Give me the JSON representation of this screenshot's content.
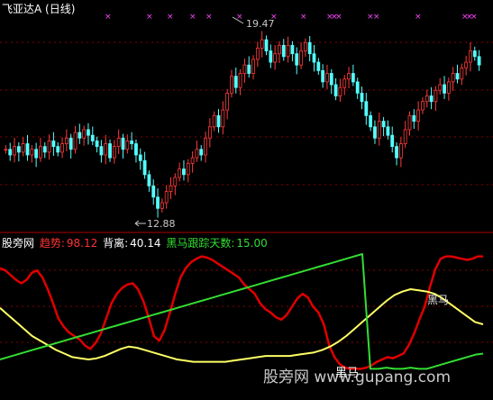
{
  "header": {
    "title": "飞亚达A (日线)"
  },
  "annotations": {
    "high_label": "19.47",
    "low_label": "12.88"
  },
  "indicator": {
    "name": "股旁网",
    "trend_label": "趋势:",
    "trend_value": "98.12",
    "deviation_label": "背离:",
    "deviation_value": "40.14",
    "tracking_label": "黑马跟踪天数:",
    "tracking_value": "15.00",
    "overlay_label": "黑马",
    "watermark": "股旁网 www.gupang.com",
    "bottom_label": "黑马"
  },
  "colors": {
    "background": "#000000",
    "up_candle": "#ff3b3b",
    "down_candle": "#54ffff",
    "cross_marker": "#ff44ff",
    "trend_line": "#e00000",
    "deviation_line": "#ffff66",
    "tracking_line": "#33dd33",
    "grid": "#8a0000"
  },
  "chart_data": [
    {
      "type": "candlestick",
      "title": "飞亚达A (日线)",
      "y_labels_printed": [
        "19.47",
        "12.88"
      ],
      "ylim": [
        12.5,
        20.0
      ],
      "closes": [
        15.2,
        15.0,
        15.3,
        15.1,
        15.4,
        15.0,
        15.2,
        14.9,
        15.3,
        15.1,
        15.5,
        15.3,
        15.1,
        15.4,
        15.6,
        15.2,
        15.8,
        15.6,
        15.9,
        15.7,
        15.5,
        15.3,
        15.0,
        15.4,
        14.9,
        15.3,
        15.6,
        15.2,
        15.5,
        15.4,
        15.0,
        14.8,
        14.3,
        13.9,
        13.5,
        13.1,
        13.3,
        13.7,
        13.9,
        14.2,
        14.5,
        14.3,
        14.7,
        14.9,
        15.2,
        15.0,
        15.6,
        16.0,
        16.4,
        16.0,
        16.6,
        17.2,
        17.8,
        17.4,
        17.9,
        18.2,
        17.9,
        18.4,
        18.8,
        19.1,
        18.7,
        18.3,
        18.6,
        18.9,
        18.5,
        18.9,
        18.6,
        18.2,
        18.7,
        19.0,
        18.6,
        18.3,
        18.0,
        17.6,
        17.9,
        17.5,
        17.1,
        17.4,
        17.7,
        17.9,
        17.6,
        17.2,
        16.9,
        16.4,
        16.0,
        15.6,
        16.2,
        16.0,
        15.7,
        15.3,
        14.9,
        15.4,
        15.9,
        16.4,
        16.2,
        16.6,
        16.9,
        17.1,
        16.9,
        17.3,
        17.5,
        17.2,
        17.6,
        17.9,
        17.7,
        18.1,
        18.3,
        18.7,
        18.5,
        18.2
      ]
    },
    {
      "type": "line",
      "series": [
        {
          "name": "趋势",
          "values": [
            88,
            86,
            82,
            78,
            75,
            78,
            84,
            86,
            80,
            70,
            58,
            45,
            38,
            33,
            30,
            27,
            22,
            19,
            24,
            32,
            45,
            58,
            66,
            71,
            74,
            75,
            70,
            60,
            46,
            30,
            26,
            35,
            50,
            66,
            80,
            88,
            93,
            96,
            98,
            97,
            95,
            92,
            89,
            86,
            83,
            80,
            74,
            70,
            66,
            58,
            53,
            50,
            46,
            44,
            48,
            55,
            62,
            66,
            63,
            55,
            50,
            40,
            22,
            12,
            6,
            3,
            2,
            2,
            2,
            3,
            5,
            8,
            10,
            12,
            11,
            13,
            15,
            22,
            32,
            44,
            55,
            72,
            87,
            96,
            98,
            98,
            97,
            96,
            95,
            96,
            98,
            98
          ]
        },
        {
          "name": "背离",
          "values": [
            54,
            48,
            42,
            36,
            30,
            26,
            22,
            18,
            15,
            12,
            11,
            10,
            11,
            13,
            16,
            19,
            21,
            20,
            18,
            16,
            14,
            12,
            10,
            9,
            8,
            8,
            8,
            8,
            8,
            9,
            10,
            11,
            12,
            13,
            13,
            13,
            13,
            14,
            15,
            16,
            18,
            21,
            25,
            30,
            36,
            42,
            48,
            54,
            60,
            65,
            68,
            70,
            69,
            68,
            66,
            62,
            57,
            52,
            47,
            42,
            40
          ]
        },
        {
          "name": "黑马跟踪天数",
          "values": [
            10,
            12,
            14,
            16,
            18,
            20,
            22,
            24,
            26,
            28,
            30,
            32,
            34,
            36,
            38,
            40,
            42,
            44,
            46,
            48,
            50,
            52,
            54,
            56,
            58,
            60,
            62,
            64,
            66,
            68,
            70,
            72,
            74,
            76,
            78,
            80,
            82,
            84,
            86,
            88,
            90,
            92,
            94,
            96,
            98,
            100,
            2,
            2,
            3,
            2,
            2,
            3,
            2,
            2,
            4,
            6,
            8,
            10,
            12,
            14,
            15
          ]
        }
      ]
    }
  ]
}
